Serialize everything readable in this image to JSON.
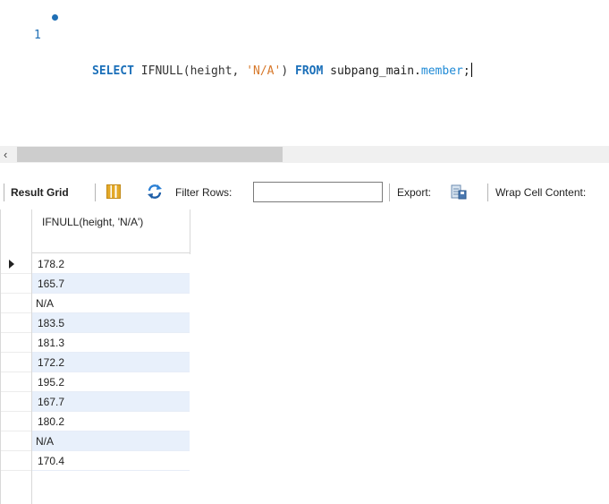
{
  "editor": {
    "line_number": "1",
    "sql": {
      "kw_select": "SELECT",
      "fn_part": " IFNULL(height, ",
      "string_lit": "'N/A'",
      "close_paren": ") ",
      "kw_from": "FROM",
      "schema": " subpang_main.",
      "table": "member",
      "terminator": ";"
    }
  },
  "toolbar": {
    "result_grid_label": "Result Grid",
    "filter_rows_label": "Filter Rows:",
    "filter_value": "",
    "export_label": "Export:",
    "wrap_label": "Wrap Cell Content:"
  },
  "grid": {
    "column_header": "IFNULL(height, 'N/A')",
    "rows": [
      "178.2",
      "165.7",
      "N/A",
      "183.5",
      "181.3",
      "172.2",
      "195.2",
      "167.7",
      "180.2",
      "N/A",
      "170.4"
    ]
  },
  "colors": {
    "keyword": "#1a6fb9",
    "string": "#d7782a",
    "row_alt": "#e8f0fb"
  },
  "icons": [
    "breakpoint-dot-icon",
    "scroll-left-icon",
    "result-grid-icon",
    "refresh-icon",
    "export-icon",
    "current-row-icon"
  ]
}
